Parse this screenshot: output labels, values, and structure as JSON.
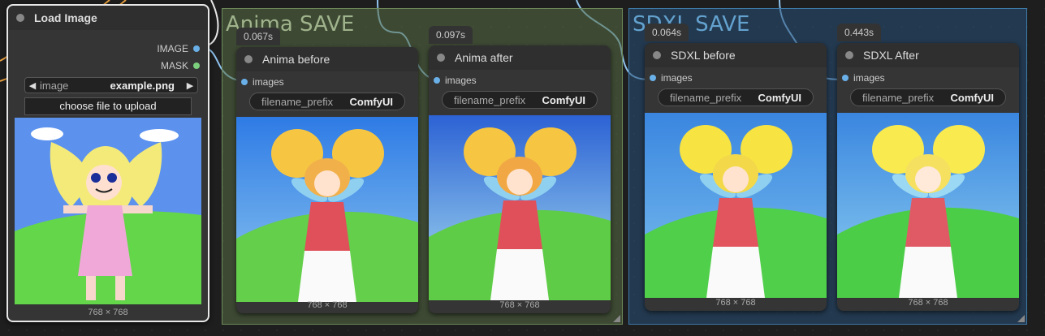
{
  "groups": {
    "anima": {
      "title": "Anima SAVE"
    },
    "sdxl": {
      "title": "SDXL SAVE"
    }
  },
  "load_node": {
    "title": "Load Image",
    "outputs": [
      "IMAGE",
      "MASK"
    ],
    "image_widget": {
      "label": "image",
      "value": "example.png"
    },
    "upload_label": "choose file to upload",
    "dims": "768 × 768"
  },
  "save_nodes": [
    {
      "title": "Anima before",
      "time": "0.067s",
      "input": "images",
      "widget_label": "filename_prefix",
      "widget_value": "ComfyUI",
      "dims": "768 × 768"
    },
    {
      "title": "Anima after",
      "time": "0.097s",
      "input": "images",
      "widget_label": "filename_prefix",
      "widget_value": "ComfyUI",
      "dims": "768 × 768"
    },
    {
      "title": "SDXL before",
      "time": "0.064s",
      "input": "images",
      "widget_label": "filename_prefix",
      "widget_value": "ComfyUI",
      "dims": "768 × 768"
    },
    {
      "title": "SDXL After",
      "time": "0.443s",
      "input": "images",
      "widget_label": "filename_prefix",
      "widget_value": "ComfyUI",
      "dims": "768 × 768"
    }
  ],
  "colors": {
    "image_slot": "#6ab0e8",
    "mask_slot": "#7ccf7c",
    "link": "#8fc3ee"
  }
}
